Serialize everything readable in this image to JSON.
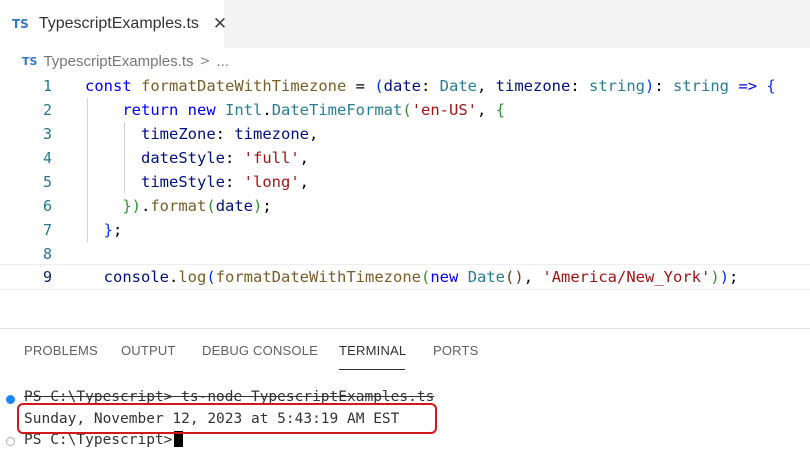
{
  "tab": {
    "badge": "TS",
    "label": "TypescriptExamples.ts",
    "close": "✕"
  },
  "breadcrumb": {
    "badge": "TS",
    "file": "TypescriptExamples.ts",
    "sep": ">",
    "more": "..."
  },
  "editor": {
    "line_numbers": [
      "1",
      "2",
      "3",
      "4",
      "5",
      "6",
      "7",
      "8",
      "9"
    ]
  },
  "panel": {
    "tabs": [
      "PROBLEMS",
      "OUTPUT",
      "DEBUG CONSOLE",
      "TERMINAL",
      "PORTS"
    ],
    "active_tab": "TERMINAL"
  },
  "terminal": {
    "line1": "PS C:\\Typescript> ts-node TypescriptExamples.ts",
    "line2": "Sunday, November 12, 2023 at 5:43:19 AM EST",
    "line3": "PS C:\\Typescript>"
  },
  "colors": {
    "highlight_box": "#d11919",
    "ts_badge": "#3178c6"
  }
}
